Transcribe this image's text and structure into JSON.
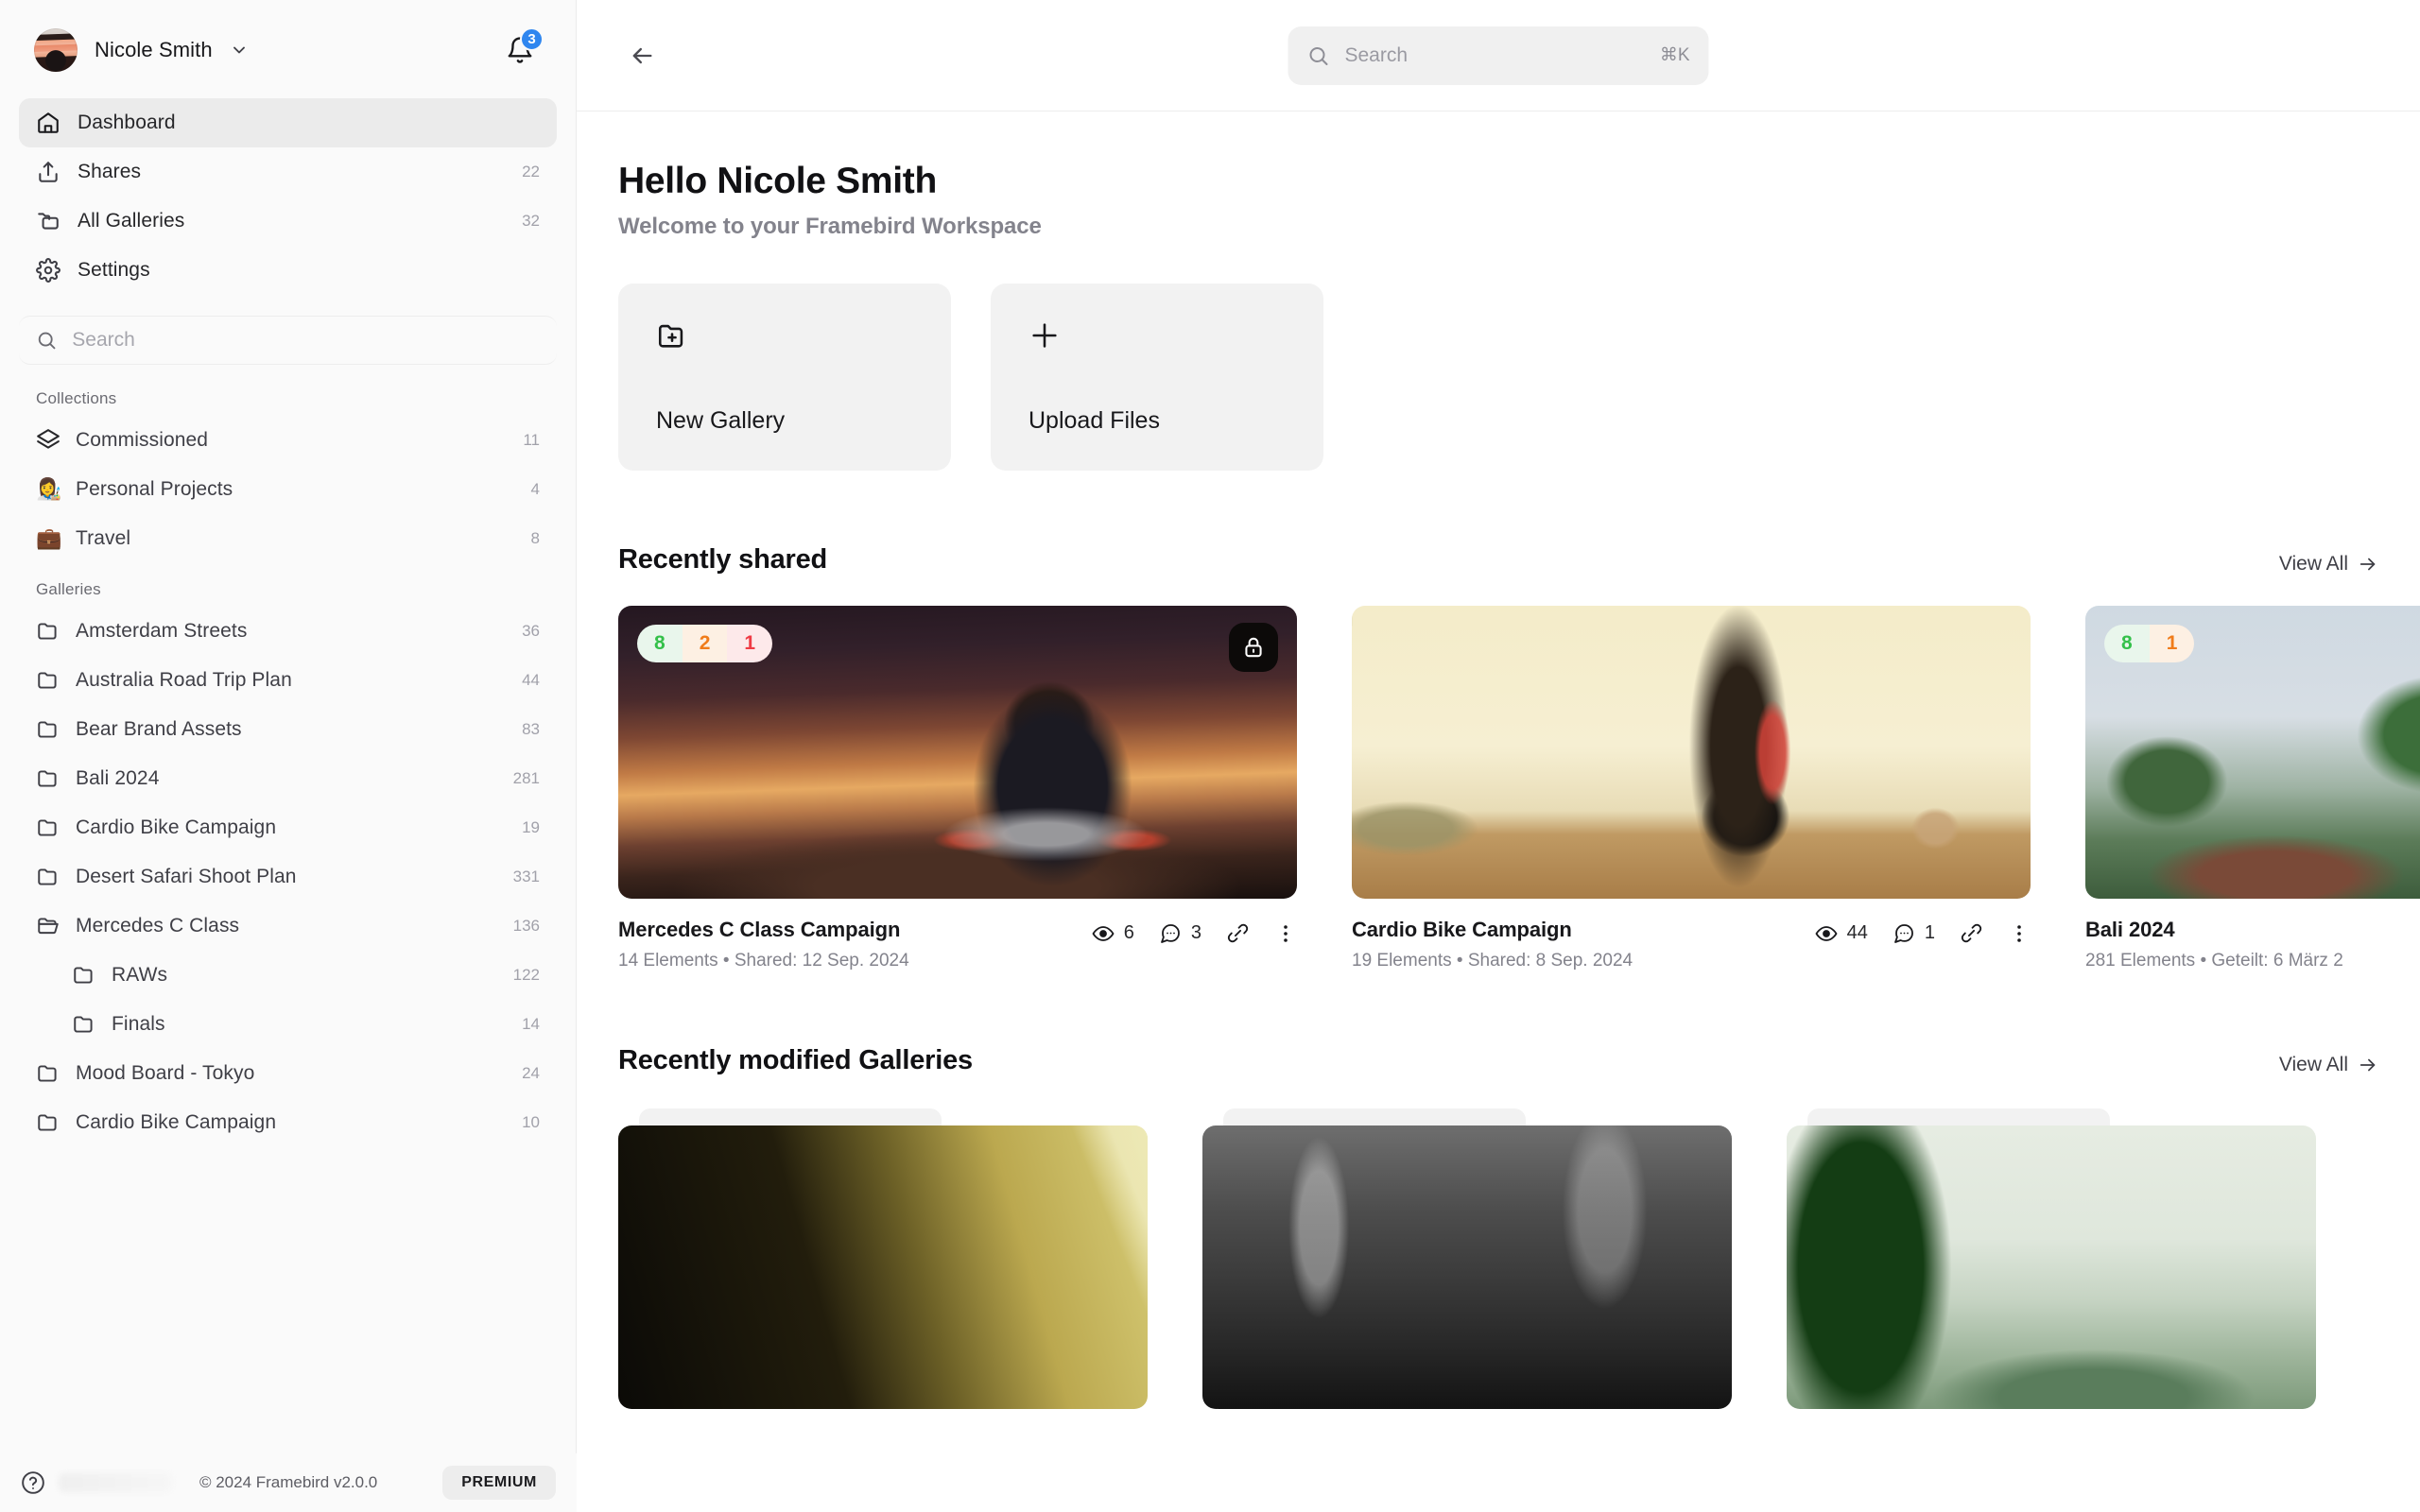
{
  "sidebar": {
    "user": {
      "name": "Nicole Smith"
    },
    "notifications": {
      "count": "3"
    },
    "nav": [
      {
        "label": "Dashboard",
        "count": "",
        "icon": "home-icon",
        "active": true
      },
      {
        "label": "Shares",
        "count": "22",
        "icon": "share-icon",
        "active": false
      },
      {
        "label": "All Galleries",
        "count": "32",
        "icon": "galleries-icon",
        "active": false
      },
      {
        "label": "Settings",
        "count": "",
        "icon": "gear-icon",
        "active": false
      }
    ],
    "search": {
      "placeholder": "Search",
      "value": ""
    },
    "collections_title": "Collections",
    "collections": [
      {
        "label": "Commissioned",
        "count": "11",
        "emoji": ""
      },
      {
        "label": "Personal Projects",
        "count": "4",
        "emoji": "👩‍🎨"
      },
      {
        "label": "Travel",
        "count": "8",
        "emoji": "💼"
      }
    ],
    "galleries_title": "Galleries",
    "galleries": [
      {
        "label": "Amsterdam Streets",
        "count": "36",
        "nested": false,
        "open": false
      },
      {
        "label": "Australia Road Trip Plan",
        "count": "44",
        "nested": false,
        "open": false
      },
      {
        "label": "Bear Brand Assets",
        "count": "83",
        "nested": false,
        "open": false
      },
      {
        "label": "Bali 2024",
        "count": "281",
        "nested": false,
        "open": false
      },
      {
        "label": "Cardio Bike Campaign",
        "count": "19",
        "nested": false,
        "open": false
      },
      {
        "label": "Desert Safari Shoot Plan",
        "count": "331",
        "nested": false,
        "open": false
      },
      {
        "label": "Mercedes C Class",
        "count": "136",
        "nested": false,
        "open": true
      },
      {
        "label": "RAWs",
        "count": "122",
        "nested": true,
        "open": false
      },
      {
        "label": "Finals",
        "count": "14",
        "nested": true,
        "open": false
      },
      {
        "label": "Mood Board - Tokyo",
        "count": "24",
        "nested": false,
        "open": false
      },
      {
        "label": "Cardio Bike Campaign",
        "count": "10",
        "nested": false,
        "open": false
      }
    ],
    "footer": {
      "copyright": "© 2024 Framebird v2.0.0",
      "premium_label": "PREMIUM"
    }
  },
  "topbar": {
    "search": {
      "placeholder": "Search",
      "value": "",
      "shortcut": "⌘K"
    }
  },
  "main": {
    "greeting": "Hello Nicole Smith",
    "subtitle": "Welcome to your Framebird Workspace",
    "quick_actions": [
      {
        "label": "New Gallery",
        "icon": "folder-plus-icon"
      },
      {
        "label": "Upload Files",
        "icon": "plus-icon"
      }
    ],
    "recently_shared": {
      "title": "Recently shared",
      "view_all": "View All",
      "cards": [
        {
          "title": "Mercedes C Class Campaign",
          "subtitle": "14 Elements • Shared: 12 Sep. 2024",
          "badges": [
            {
              "value": "8",
              "tone": "green"
            },
            {
              "value": "2",
              "tone": "amber"
            },
            {
              "value": "1",
              "tone": "red"
            }
          ],
          "locked": true,
          "views": "6",
          "comments": "3",
          "photo": "ph-mercedes"
        },
        {
          "title": "Cardio Bike Campaign",
          "subtitle": "19 Elements • Shared: 8 Sep. 2024",
          "badges": [],
          "locked": false,
          "views": "44",
          "comments": "1",
          "photo": "ph-cardio"
        },
        {
          "title": "Bali 2024",
          "subtitle": "281 Elements • Geteilt: 6 März 2",
          "badges": [
            {
              "value": "8",
              "tone": "green"
            },
            {
              "value": "1",
              "tone": "amber"
            }
          ],
          "locked": false,
          "views": "",
          "comments": "",
          "photo": "ph-bali"
        }
      ]
    },
    "recently_modified": {
      "title": "Recently modified Galleries",
      "view_all": "View All",
      "cards": [
        {
          "photo": "ph-tunnel"
        },
        {
          "photo": "ph-street"
        },
        {
          "photo": "ph-jungle"
        }
      ]
    }
  },
  "colors": {
    "accent_blue": "#2f86ef",
    "badge_green": "#34c04a",
    "badge_amber": "#f07c1a",
    "badge_red": "#ef3b44"
  }
}
